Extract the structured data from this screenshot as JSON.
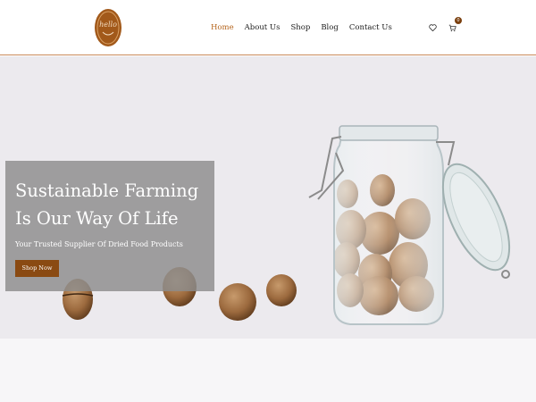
{
  "brand": {
    "logo_text": "hello"
  },
  "nav": {
    "items": [
      {
        "label": "Home",
        "active": true
      },
      {
        "label": "About Us",
        "active": false
      },
      {
        "label": "Shop",
        "active": false
      },
      {
        "label": "Blog",
        "active": false
      },
      {
        "label": "Contact Us",
        "active": false
      }
    ]
  },
  "header_icons": {
    "wishlist_icon": "heart-icon",
    "cart_icon": "cart-icon",
    "cart_count": "0"
  },
  "hero": {
    "title_line1": "Sustainable Farming",
    "title_line2": "Is Our Way Of Life",
    "subtitle": "Your Trusted Supplier Of Dried Food Products",
    "cta_label": "Shop Now"
  },
  "colors": {
    "accent": "#b5651d",
    "button": "#8a4a12",
    "overlay": "#8c8c8c",
    "background": "#eceaee"
  }
}
